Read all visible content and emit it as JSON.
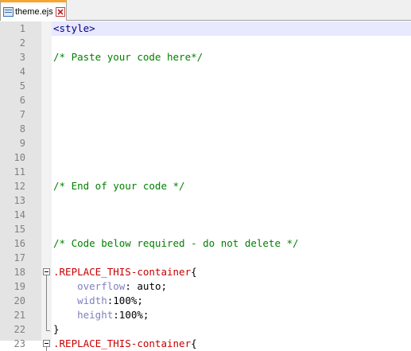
{
  "tab": {
    "file_name": "theme.ejs",
    "icon": "file-icon",
    "close_icon": "close-icon",
    "accent": "#f8a530"
  },
  "editor": {
    "current_line": 1,
    "lines": [
      {
        "num": "1",
        "tokens": [
          {
            "t": "tag",
            "v": "<style>"
          }
        ]
      },
      {
        "num": "2",
        "tokens": []
      },
      {
        "num": "3",
        "tokens": [
          {
            "t": "comment",
            "v": "/* Paste your code here*/"
          }
        ]
      },
      {
        "num": "4",
        "tokens": []
      },
      {
        "num": "5",
        "tokens": []
      },
      {
        "num": "6",
        "tokens": []
      },
      {
        "num": "7",
        "tokens": []
      },
      {
        "num": "8",
        "tokens": []
      },
      {
        "num": "9",
        "tokens": []
      },
      {
        "num": "10",
        "tokens": []
      },
      {
        "num": "11",
        "tokens": []
      },
      {
        "num": "12",
        "tokens": [
          {
            "t": "comment",
            "v": "/* End of your code */"
          }
        ]
      },
      {
        "num": "13",
        "tokens": []
      },
      {
        "num": "14",
        "tokens": []
      },
      {
        "num": "15",
        "tokens": []
      },
      {
        "num": "16",
        "tokens": [
          {
            "t": "comment",
            "v": "/* Code below required - do not delete */"
          }
        ]
      },
      {
        "num": "17",
        "tokens": []
      },
      {
        "num": "18",
        "fold": "open",
        "tokens": [
          {
            "t": "selector",
            "v": ".REPLACE_THIS-container"
          },
          {
            "t": "punct",
            "v": "{"
          }
        ]
      },
      {
        "num": "19",
        "fold": "line",
        "tokens": [
          {
            "t": "value",
            "v": "    "
          },
          {
            "t": "prop",
            "v": "overflow"
          },
          {
            "t": "punct",
            "v": ": "
          },
          {
            "t": "value",
            "v": "auto"
          },
          {
            "t": "punct",
            "v": ";"
          }
        ]
      },
      {
        "num": "20",
        "fold": "line",
        "tokens": [
          {
            "t": "value",
            "v": "    "
          },
          {
            "t": "prop",
            "v": "width"
          },
          {
            "t": "punct",
            "v": ":"
          },
          {
            "t": "value",
            "v": "100%"
          },
          {
            "t": "punct",
            "v": ";"
          }
        ]
      },
      {
        "num": "21",
        "fold": "line",
        "tokens": [
          {
            "t": "value",
            "v": "    "
          },
          {
            "t": "prop",
            "v": "height"
          },
          {
            "t": "punct",
            "v": ":"
          },
          {
            "t": "value",
            "v": "100%"
          },
          {
            "t": "punct",
            "v": ";"
          }
        ]
      },
      {
        "num": "22",
        "fold": "end",
        "tokens": [
          {
            "t": "punct",
            "v": "}"
          }
        ]
      },
      {
        "num": "23",
        "fold": "open",
        "tokens": [
          {
            "t": "selector",
            "v": ".REPLACE_THIS-container"
          },
          {
            "t": "punct",
            "v": "{"
          }
        ]
      }
    ]
  }
}
